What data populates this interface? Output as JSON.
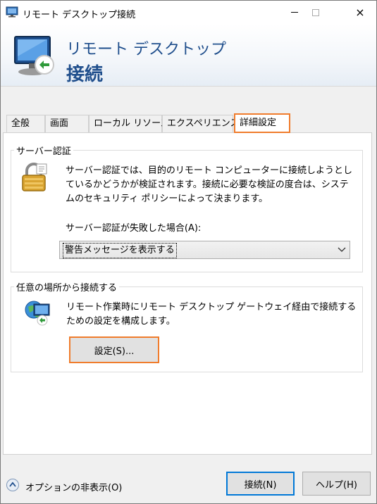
{
  "window": {
    "title": "リモート デスクトップ接続",
    "controls": {
      "minimize": "minimize-icon",
      "maximize": "maximize-icon",
      "close": "×"
    }
  },
  "banner": {
    "line1": "リモート デスクトップ",
    "line2": "接続"
  },
  "tabs": [
    {
      "label": "全般",
      "selected": false
    },
    {
      "label": "画面",
      "selected": false
    },
    {
      "label": "ローカル リソース",
      "selected": false
    },
    {
      "label": "エクスペリエンス",
      "selected": false
    },
    {
      "label": "詳細設定",
      "selected": true
    }
  ],
  "server_auth": {
    "title": "サーバー認証",
    "description": "サーバー認証では、目的のリモート コンピューターに接続しようとしているかどうかが検証されます。接続に必要な検証の度合は、システムのセキュリティ ポリシーによって決まります。",
    "fail_label": "サーバー認証が失敗した場合(A):",
    "fail_value": "警告メッセージを表示する"
  },
  "gateway": {
    "title": "任意の場所から接続する",
    "description": "リモート作業時にリモート デスクトップ ゲートウェイ経由で接続するための設定を構成します。",
    "settings_button": "設定(S)..."
  },
  "footer": {
    "options_toggle": "オプションの非表示(O)",
    "connect_button": "接続(N)",
    "help_button": "ヘルプ(H)"
  },
  "colors": {
    "highlight": "#f07c2c",
    "banner_text": "#1f4e8c",
    "default_button": "#0078d7"
  }
}
